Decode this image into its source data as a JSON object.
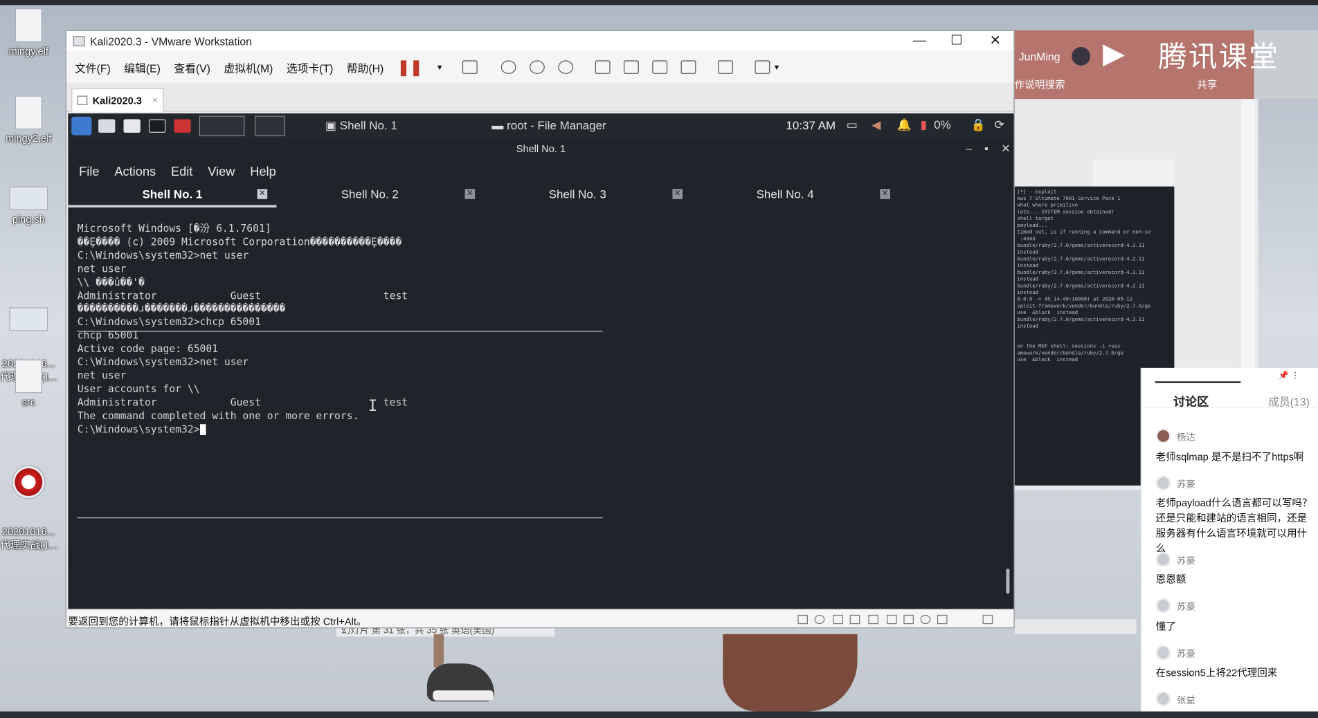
{
  "desktop": {
    "icons": [
      {
        "label": "mingy.elf"
      },
      {
        "label": "mingy2.elf"
      },
      {
        "label": "ping.sh"
      },
      {
        "label": "20201016...\n代理实战(1..."
      },
      {
        "label": "src"
      },
      {
        "label": "20201016...\n代理实战(1..."
      }
    ]
  },
  "background_app": {
    "brand": "腾讯课堂",
    "user": "JunMing",
    "search": "作说明搜索",
    "share": "共享",
    "ppt_status": "幻灯片 第 31 张，共 35 张    英语(美国)"
  },
  "vmware": {
    "title": "Kali2020.3 - VMware Workstation",
    "controls": {
      "minimize": "—",
      "maximize": "☐",
      "close": "✕"
    },
    "menu": [
      "文件(F)",
      "编辑(E)",
      "查看(V)",
      "虚拟机(M)",
      "选项卡(T)",
      "帮助(H)"
    ],
    "tab": "Kali2020.3",
    "status": "要返回到您的计算机，请将鼠标指针从虚拟机中移出或按 Ctrl+Alt。"
  },
  "kali": {
    "taskbar": [
      "Shell No. 1",
      "root - File Manager"
    ],
    "clock": "10:37 AM",
    "battery": "0%",
    "terminal_title": "Shell No. 1",
    "terminal_menu": [
      "File",
      "Actions",
      "Edit",
      "View",
      "Help"
    ],
    "terminal_tabs": [
      "Shell No. 1",
      "Shell No. 2",
      "Shell No. 3",
      "Shell No. 4"
    ],
    "output": [
      "Microsoft Windows [�汾 6.1.7601]",
      "��Ȩ���� (c) 2009 Microsoft Corporation����������Ȩ����",
      "",
      "C:\\Windows\\system32>net user",
      "net user",
      "",
      "\\\\ ���û��'�",
      "",
      "",
      "Administrator            Guest                    test",
      "����������ɹ�������ɹ���������������",
      "",
      "",
      "C:\\Windows\\system32>chcp 65001",
      "chcp 65001",
      "Active code page: 65001",
      "",
      "C:\\Windows\\system32>net user",
      "net user",
      "",
      "User accounts for \\\\",
      "",
      "",
      "Administrator            Guest                    test",
      "The command completed with one or more errors.",
      "",
      "",
      "C:\\Windows\\system32>"
    ]
  },
  "discussion": {
    "tab_discuss": "讨论区",
    "tab_members": "成员(13)",
    "messages": [
      {
        "name": "杨达",
        "text": "老师sqlmap 是不是扫不了https啊"
      },
      {
        "name": "苏豪",
        "text": "老师payload什么语言都可以写吗？还是只能和建站的语言相同，还是服务器有什么语言环境就可以用什么"
      },
      {
        "name": "苏豪",
        "text": "恩恩额"
      },
      {
        "name": "苏豪",
        "text": "懂了"
      },
      {
        "name": "苏豪",
        "text": "在session5上将22代理回来"
      },
      {
        "name": "张益",
        "text": ""
      }
    ]
  }
}
